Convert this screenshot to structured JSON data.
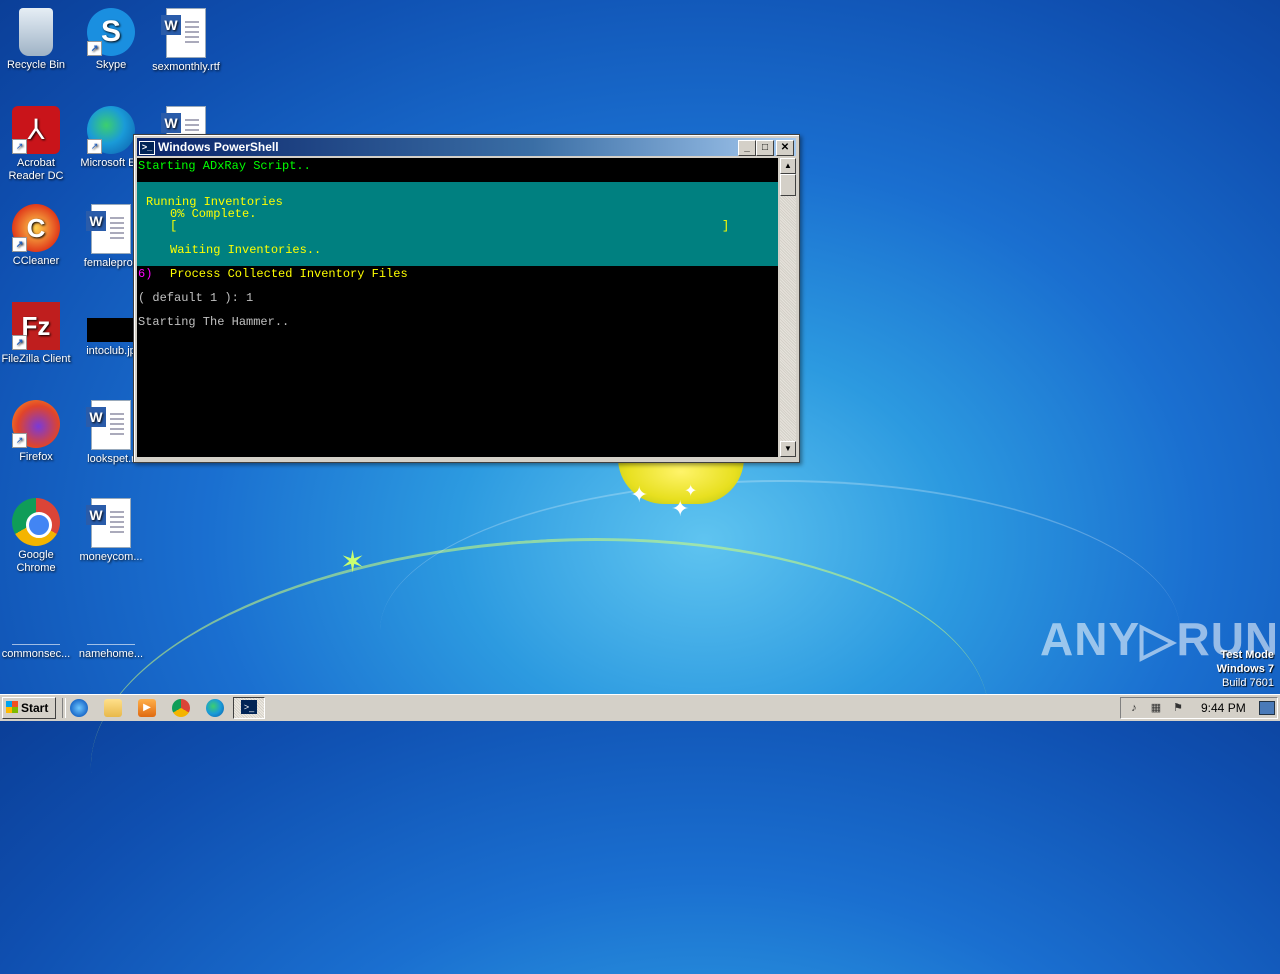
{
  "desktop": {
    "icons": [
      {
        "label": "Recycle Bin",
        "icon": "recycle-bin-icon"
      },
      {
        "label": "Skype",
        "icon": "skype-icon"
      },
      {
        "label": "sexmonthly.rtf",
        "icon": "word-doc-icon"
      },
      {
        "label": "Acrobat Reader DC",
        "icon": "acrobat-icon"
      },
      {
        "label": "Microsoft Ed",
        "icon": "edge-icon"
      },
      {
        "label": "CCleaner",
        "icon": "ccleaner-icon"
      },
      {
        "label": "femaleprov",
        "icon": "word-doc-icon"
      },
      {
        "label": "FileZilla Client",
        "icon": "filezilla-icon"
      },
      {
        "label": "intoclub.jp",
        "icon": "image-file-icon"
      },
      {
        "label": "Firefox",
        "icon": "firefox-icon"
      },
      {
        "label": "lookspet.r",
        "icon": "word-doc-icon"
      },
      {
        "label": "Google Chrome",
        "icon": "chrome-icon"
      },
      {
        "label": "moneycom...",
        "icon": "word-doc-icon"
      },
      {
        "label": "commonsec...",
        "icon": "file-icon"
      },
      {
        "label": "namehome...",
        "icon": "file-icon"
      }
    ]
  },
  "powershell": {
    "title": "Windows PowerShell",
    "buttons": {
      "minimize": "_",
      "maximize": "□",
      "close": "✕"
    },
    "console": {
      "line_starting": "Starting ADxRay Script..",
      "progress_title": "Running Inventories",
      "progress_percent": "0% Complete.",
      "progress_bar_open": "[",
      "progress_bar_close": "]",
      "progress_status": "Waiting Inventories..",
      "menu_number": "6)",
      "menu_text": "Process Collected Inventory Files",
      "prompt": "( default 1 ): 1",
      "hammer": "Starting The Hammer.."
    },
    "colors": {
      "console_bg": "#000000",
      "progress_bg": "#008080",
      "green": "#00ff00",
      "yellow": "#ffff00",
      "magenta": "#ff00ff"
    }
  },
  "watermark": {
    "brand": "ANY▷RUN"
  },
  "test_mode": {
    "line1": "Test Mode",
    "line2": "Windows 7",
    "line3": "Build 7601"
  },
  "taskbar": {
    "start_label": "Start",
    "clock": "9:44 PM",
    "quick_launch": [
      "internet-explorer-icon",
      "folder-icon",
      "media-player-icon",
      "chrome-icon",
      "edge-icon"
    ],
    "active_task": "powershell-icon"
  }
}
